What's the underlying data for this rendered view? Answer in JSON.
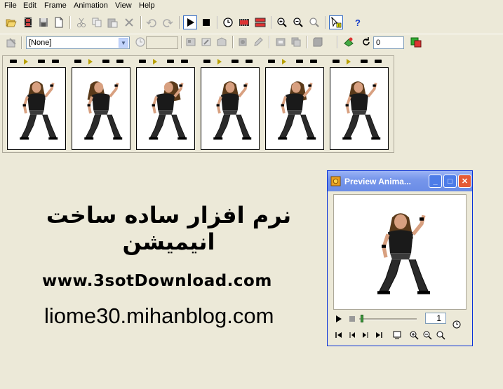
{
  "menu": [
    "File",
    "Edit",
    "Frame",
    "Animation",
    "View",
    "Help"
  ],
  "frame_delay_combo": {
    "value": "[None]"
  },
  "loop_count_field": {
    "value": "0"
  },
  "filmstrip": {
    "frame_count": 6
  },
  "promo": {
    "persian_title": "نرم افزار ساده ساخت انیمیشن",
    "website": "www.3sotDownload.com",
    "blog": "liome30.mihanblog.com"
  },
  "preview_window": {
    "title": "Preview Anima...",
    "frame_number": "1",
    "minimize_glyph": "_",
    "maximize_glyph": "□",
    "close_glyph": "✕"
  },
  "colors": {
    "workspace": "#ece9d8",
    "xp_title": "#6a8ce6",
    "close": "#e55b36"
  }
}
